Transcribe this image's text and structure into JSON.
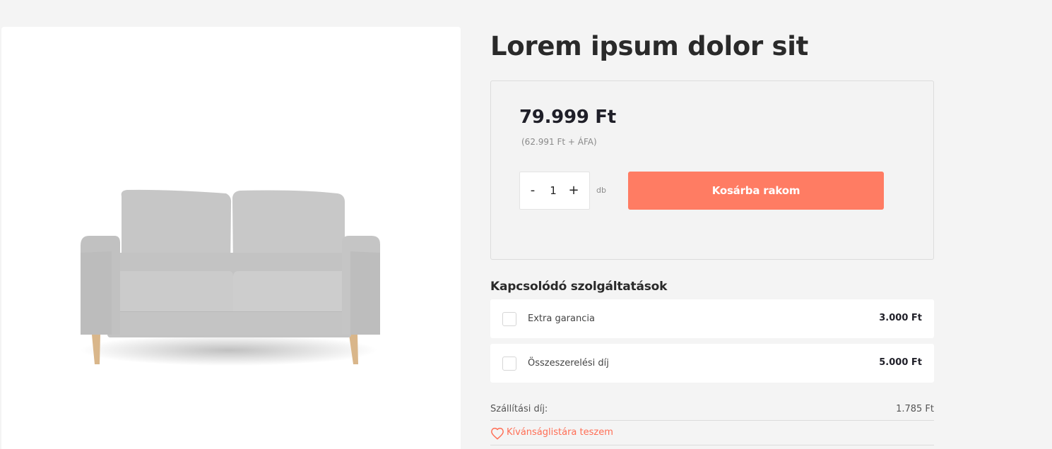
{
  "product": {
    "title": "Lorem ipsum dolor sit",
    "price": "79.999 Ft",
    "net_price": "(62.991 Ft + ÁFA)",
    "image_icon": "sofa-image"
  },
  "quantity": {
    "minus_label": "-",
    "value": "1",
    "plus_label": "+",
    "unit": "db"
  },
  "cart": {
    "button_label": "Kosárba rakom",
    "accent_color": "#ff7c63"
  },
  "services": {
    "title": "Kapcsolódó szolgáltatások",
    "items": [
      {
        "label": "Extra garancia",
        "price": "3.000 Ft"
      },
      {
        "label": "Összeszerelési díj",
        "price": "5.000 Ft"
      }
    ]
  },
  "shipping": {
    "label": "Szállítási díj:",
    "value": "1.785 Ft"
  },
  "wishlist": {
    "label": "Kívánságlistára teszem",
    "icon": "heart-icon"
  }
}
